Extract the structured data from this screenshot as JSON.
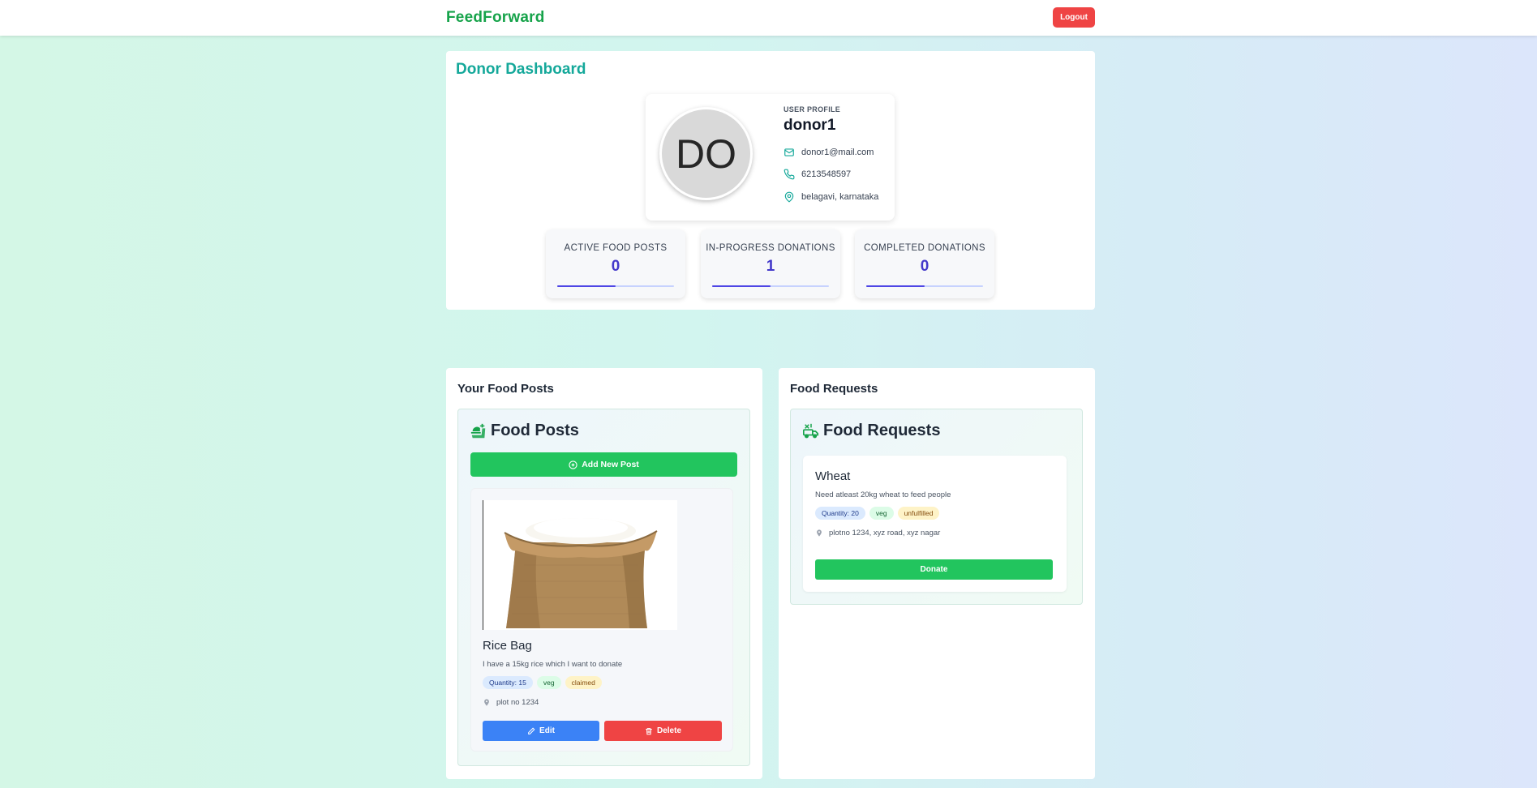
{
  "app": {
    "brand": "FeedForward",
    "logout_label": "Logout"
  },
  "dashboard": {
    "title": "Donor Dashboard",
    "profile": {
      "label": "USER PROFILE",
      "avatar_initials": "DO",
      "name": "donor1",
      "email": "donor1@mail.com",
      "phone": "6213548597",
      "location": "belagavi, karnataka"
    },
    "stats": [
      {
        "label": "ACTIVE FOOD POSTS",
        "value": "0",
        "progress": 0.5
      },
      {
        "label": "IN-PROGRESS DONATIONS",
        "value": "1",
        "progress": 0.5
      },
      {
        "label": "COMPLETED DONATIONS",
        "value": "0",
        "progress": 0.5
      }
    ]
  },
  "food_posts_panel": {
    "heading": "Your Food Posts",
    "inner_title": "Food Posts",
    "add_button_label": "Add New Post",
    "posts": [
      {
        "title": "Rice Bag",
        "description": "I have a 15kg rice which I want to donate",
        "quantity_tag": "Quantity: 15",
        "type_tag": "veg",
        "status_tag": "claimed",
        "location": "plot no 1234",
        "edit_label": "Edit",
        "delete_label": "Delete"
      }
    ]
  },
  "food_requests_panel": {
    "heading": "Food Requests",
    "inner_title": "Food Requests",
    "requests": [
      {
        "title": "Wheat",
        "description": "Need atleast 20kg wheat to feed people",
        "quantity_tag": "Quantity: 20",
        "type_tag": "veg",
        "status_tag": "unfulfilled",
        "location": "plotno 1234, xyz road, xyz nagar",
        "donate_label": "Donate"
      }
    ]
  },
  "colors": {
    "brand": "#16a34a",
    "accent_teal": "#14a89a",
    "stat_value": "#4338ca",
    "primary_green": "#22c55e",
    "edit_blue": "#3b82f6",
    "danger_red": "#ef4444"
  }
}
